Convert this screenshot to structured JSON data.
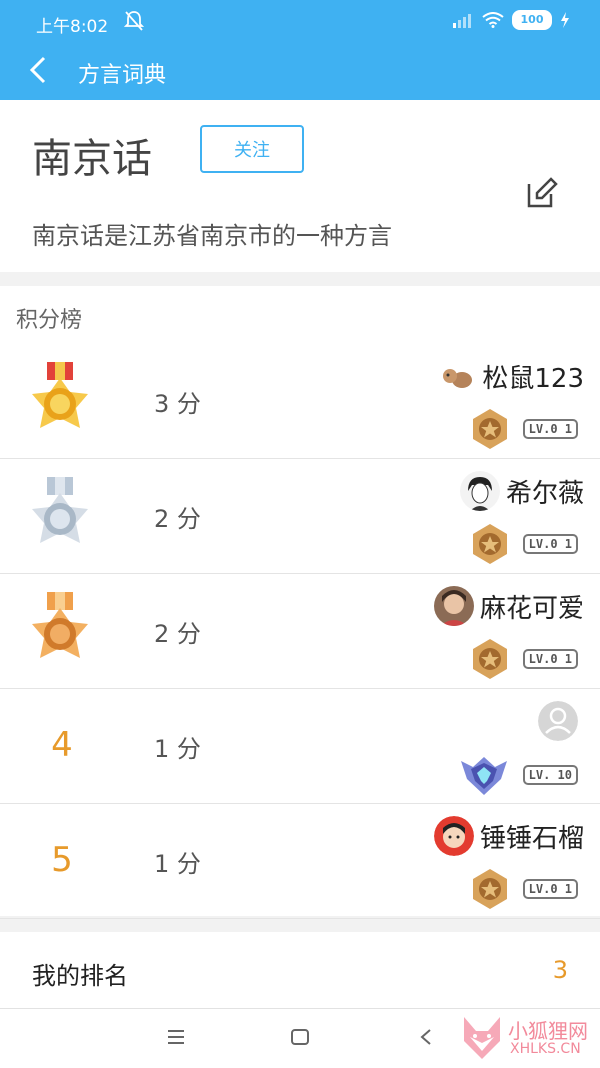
{
  "status_bar": {
    "time": "上午8:02",
    "battery": "100"
  },
  "app_bar": {
    "title": "方言词典"
  },
  "dialect": {
    "name": "南京话",
    "follow_label": "关注",
    "description": "南京话是江苏省南京市的一种方言"
  },
  "leaderboard": {
    "title": "积分榜",
    "rows": [
      {
        "rank": "1",
        "score": "3 分",
        "username": "松鼠123",
        "level": "LV.0 1",
        "medal": "gold"
      },
      {
        "rank": "2",
        "score": "2 分",
        "username": "希尔薇",
        "level": "LV.0 1",
        "medal": "silver"
      },
      {
        "rank": "3",
        "score": "2 分",
        "username": "麻花可爱",
        "level": "LV.0 1",
        "medal": "bronze"
      },
      {
        "rank": "4",
        "score": "1 分",
        "username": "",
        "level": "LV. 10",
        "medal": "none"
      },
      {
        "rank": "5",
        "score": "1 分",
        "username": "锤锤石榴",
        "level": "LV.0 1",
        "medal": "none"
      }
    ]
  },
  "my_rank": {
    "label": "我的排名",
    "value": "3"
  },
  "watermark": {
    "line1": "小狐狸网",
    "line2": "XHLKS.CN"
  },
  "colors": {
    "primary": "#3fb1f2",
    "rank_accent": "#e79a2b"
  }
}
